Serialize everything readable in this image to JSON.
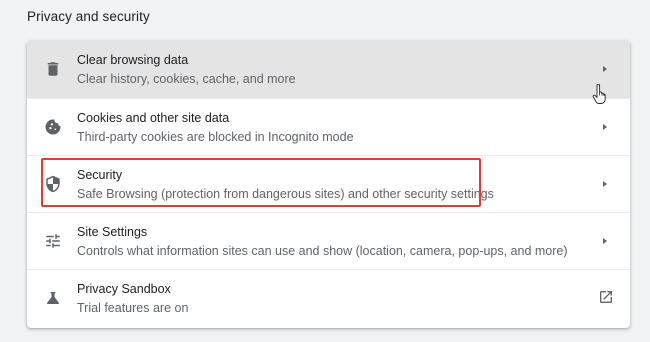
{
  "section": {
    "title": "Privacy and security"
  },
  "rows": [
    {
      "title": "Clear browsing data",
      "subtitle": "Clear history, cookies, cache, and more",
      "icon": "trash-icon",
      "action": "chevron-right-icon"
    },
    {
      "title": "Cookies and other site data",
      "subtitle": "Third-party cookies are blocked in Incognito mode",
      "icon": "cookie-icon",
      "action": "chevron-right-icon"
    },
    {
      "title": "Security",
      "subtitle": "Safe Browsing (protection from dangerous sites) and other security settings",
      "icon": "shield-icon",
      "action": "chevron-right-icon"
    },
    {
      "title": "Site Settings",
      "subtitle": "Controls what information sites can use and show (location, camera, pop-ups, and more)",
      "icon": "tune-icon",
      "action": "chevron-right-icon"
    },
    {
      "title": "Privacy Sandbox",
      "subtitle": "Trial features are on",
      "icon": "flask-icon",
      "action": "open-in-new-icon"
    }
  ],
  "colors": {
    "page_background": "#f1f3f4",
    "card_background": "#ffffff",
    "hover_background": "#e4e4e4",
    "primary_text": "#202124",
    "secondary_text": "#5f6368",
    "icon": "#5f6368",
    "highlight_border": "#e53935"
  }
}
